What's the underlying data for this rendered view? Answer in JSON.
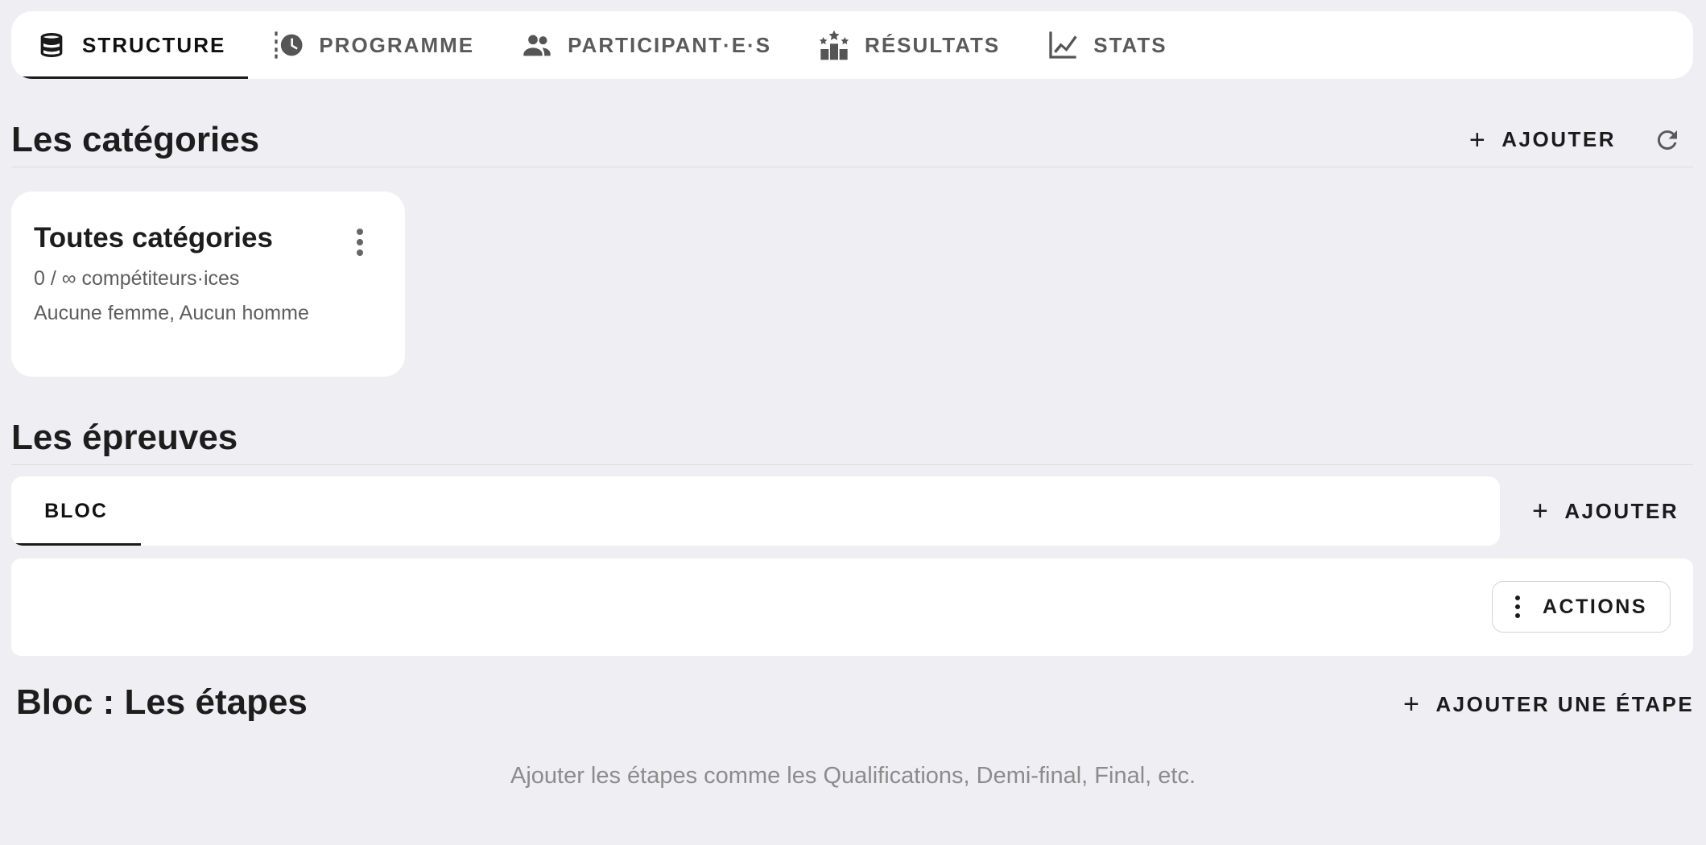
{
  "nav": {
    "tabs": [
      {
        "label": "STRUCTURE",
        "icon": "database-icon"
      },
      {
        "label": "PROGRAMME",
        "icon": "schedule-icon"
      },
      {
        "label": "PARTICIPANT·E·S",
        "icon": "people-icon"
      },
      {
        "label": "RÉSULTATS",
        "icon": "podium-icon"
      },
      {
        "label": "STATS",
        "icon": "line-chart-icon"
      }
    ],
    "active": "STRUCTURE"
  },
  "categories": {
    "title": "Les catégories",
    "add_label": "AJOUTER",
    "card": {
      "title": "Toutes catégories",
      "line1": "0 / ∞ compétiteurs·ices",
      "line2": "Aucune femme, Aucun homme"
    }
  },
  "events": {
    "title": "Les épreuves",
    "tab_label": "BLOC",
    "add_label": "AJOUTER",
    "actions_label": "ACTIONS"
  },
  "stages": {
    "title": "Bloc : Les étapes",
    "add_label": "AJOUTER UNE ÉTAPE",
    "hint": "Ajouter les étapes comme les Qualifications, Demi-final, Final, etc."
  },
  "colors": {
    "background": "#efeef3",
    "surface": "#ffffff",
    "text": "#1f1f1f",
    "muted": "#8c8c8c"
  }
}
